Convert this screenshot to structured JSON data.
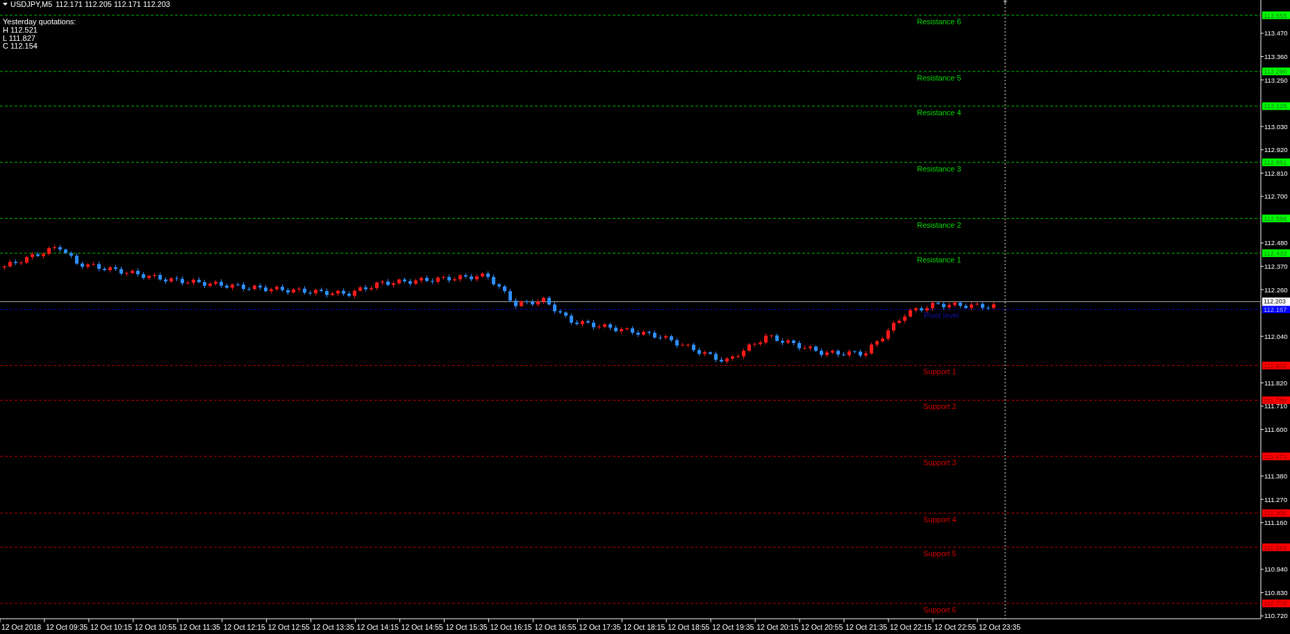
{
  "header": {
    "symbol": "USDJPY,M5",
    "quotes": "112.171 112.205 112.171 112.203"
  },
  "yesterday": {
    "title": "Yesterday quotations:",
    "lines": [
      "H 112.521",
      "L 111.827",
      "C 112.154"
    ]
  },
  "levels": [
    {
      "kind": "resistance",
      "label": "Resistance 6",
      "price": "113.555",
      "color": "#00ff00"
    },
    {
      "kind": "resistance",
      "label": "Resistance 5",
      "price": "113.290",
      "color": "#00ff00"
    },
    {
      "kind": "resistance",
      "label": "Resistance 4",
      "price": "113.126",
      "color": "#00ff00"
    },
    {
      "kind": "resistance",
      "label": "Resistance 3",
      "price": "112.861",
      "color": "#00ff00"
    },
    {
      "kind": "resistance",
      "label": "Resistance 2",
      "price": "112.596",
      "color": "#00ff00"
    },
    {
      "kind": "resistance",
      "label": "Resistance 1",
      "price": "112.432",
      "color": "#00ff00"
    },
    {
      "kind": "pivot",
      "label": "Pivot level",
      "price": "112.167",
      "color": "#0000ff"
    },
    {
      "kind": "support",
      "label": "Support 1",
      "price": "111.902",
      "color": "#ff0000"
    },
    {
      "kind": "support",
      "label": "Support 2",
      "price": "111.738",
      "color": "#ff0000"
    },
    {
      "kind": "support",
      "label": "Support 3",
      "price": "111.473",
      "color": "#ff0000"
    },
    {
      "kind": "support",
      "label": "Support 4",
      "price": "111.205",
      "color": "#ff0000"
    },
    {
      "kind": "support",
      "label": "Support 5",
      "price": "111.044",
      "color": "#ff0000"
    },
    {
      "kind": "support",
      "label": "Support 6",
      "price": "110.779",
      "color": "#ff0000"
    }
  ],
  "current_price": "112.203",
  "price_axis": [
    "113.470",
    "113.360",
    "113.250",
    "113.030",
    "112.920",
    "112.810",
    "112.700",
    "112.480",
    "112.370",
    "112.260",
    "112.040",
    "111.820",
    "111.710",
    "111.600",
    "111.380",
    "111.270",
    "111.160",
    "110.940",
    "110.830",
    "110.720"
  ],
  "time_axis": [
    "12 Oct 2018",
    "12 Oct 09:35",
    "12 Oct 10:15",
    "12 Oct 10:55",
    "12 Oct 11:35",
    "12 Oct 12:15",
    "12 Oct 12:55",
    "12 Oct 13:35",
    "12 Oct 14:15",
    "12 Oct 14:55",
    "12 Oct 15:35",
    "12 Oct 16:15",
    "12 Oct 16:55",
    "12 Oct 17:35",
    "12 Oct 18:15",
    "12 Oct 18:55",
    "12 Oct 19:35",
    "12 Oct 20:15",
    "12 Oct 20:55",
    "12 Oct 21:35",
    "12 Oct 22:15",
    "12 Oct 22:55",
    "12 Oct 23:35"
  ]
}
